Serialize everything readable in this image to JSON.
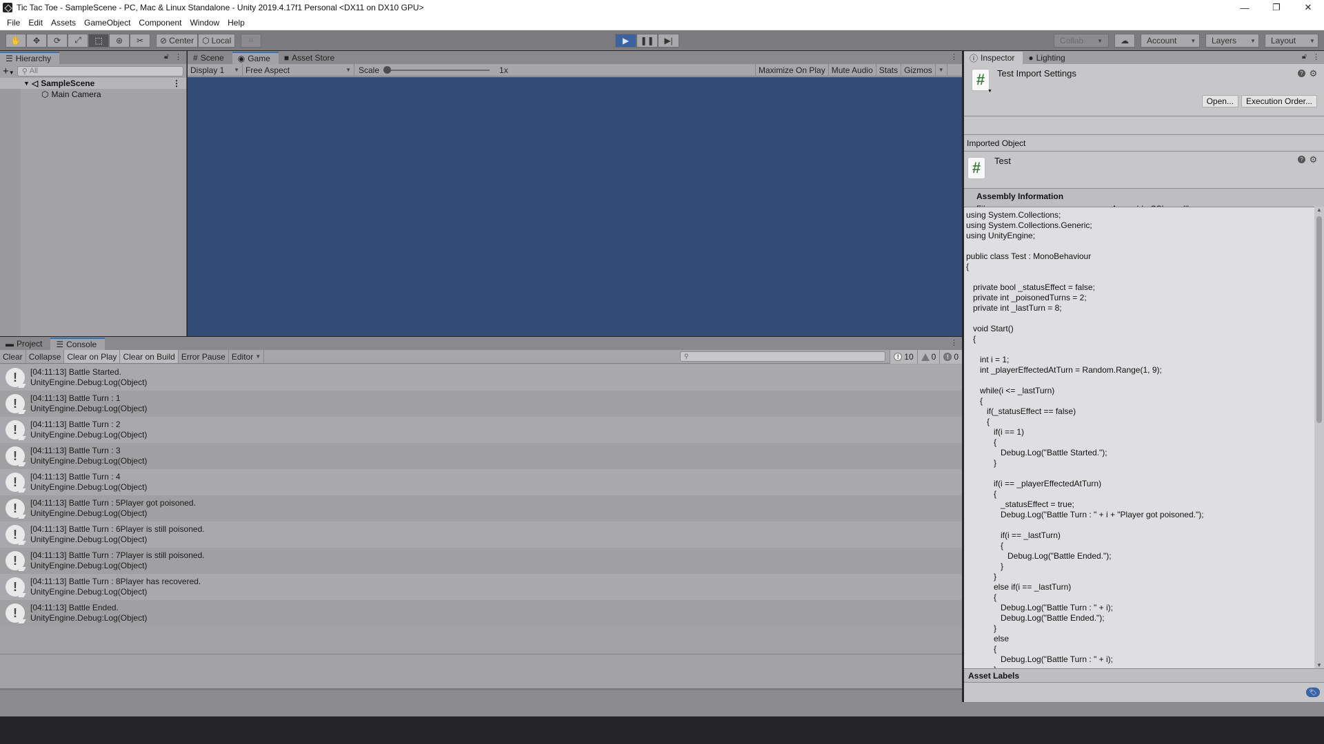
{
  "window": {
    "title": "Tic Tac Toe - SampleScene - PC, Mac & Linux Standalone - Unity 2019.4.17f1 Personal <DX11 on DX10 GPU>",
    "controls": {
      "minimize": "—",
      "maximize": "❐",
      "close": "✕"
    }
  },
  "menu": [
    "File",
    "Edit",
    "Assets",
    "GameObject",
    "Component",
    "Window",
    "Help"
  ],
  "toolbar": {
    "tools": [
      {
        "name": "hand-tool",
        "glyph": "✋"
      },
      {
        "name": "move-tool",
        "glyph": "✥"
      },
      {
        "name": "rotate-tool",
        "glyph": "⟳"
      },
      {
        "name": "scale-tool",
        "glyph": "⤢"
      },
      {
        "name": "rect-tool",
        "glyph": "⬚"
      },
      {
        "name": "transform-tool",
        "glyph": "⊛"
      },
      {
        "name": "custom-tool",
        "glyph": "✂"
      }
    ],
    "pivot_center": "Center",
    "pivot_local": "Local",
    "grid_snap_glyph": "⌗",
    "play": "▶",
    "pause": "❚❚",
    "step": "▶|",
    "collab": "Collab",
    "cloud_glyph": "☁",
    "account": "Account",
    "layers": "Layers",
    "layout": "Layout"
  },
  "hierarchy": {
    "tab": "Hierarchy",
    "add_glyph": "+",
    "search_placeholder": "All",
    "scene": "SampleScene",
    "children": [
      "Main Camera"
    ]
  },
  "center_tabs": [
    {
      "label": "Scene",
      "glyph": "#"
    },
    {
      "label": "Game",
      "glyph": "◉"
    },
    {
      "label": "Asset Store",
      "glyph": "■"
    }
  ],
  "game_toolbar": {
    "display": "Display 1",
    "aspect": "Free Aspect",
    "scale_label": "Scale",
    "scale_value": "1x",
    "scale_fraction": 0.0,
    "maximize_on_play": "Maximize On Play",
    "mute_audio": "Mute Audio",
    "stats": "Stats",
    "gizmos": "Gizmos"
  },
  "game_view_color": "#324b77",
  "bottom_tabs": [
    {
      "label": "Project",
      "glyph": "▬"
    },
    {
      "label": "Console",
      "glyph": "☰"
    }
  ],
  "console": {
    "buttons": [
      "Clear",
      "Collapse",
      "Clear on Play",
      "Clear on Build",
      "Error Pause",
      "Editor"
    ],
    "counts": {
      "log": "10",
      "warning": "0",
      "error": "0"
    },
    "entries": [
      {
        "message": "[04:11:13] Battle Started.",
        "trace": "UnityEngine.Debug:Log(Object)"
      },
      {
        "message": "[04:11:13] Battle Turn : 1",
        "trace": "UnityEngine.Debug:Log(Object)"
      },
      {
        "message": "[04:11:13] Battle Turn : 2",
        "trace": "UnityEngine.Debug:Log(Object)"
      },
      {
        "message": "[04:11:13] Battle Turn : 3",
        "trace": "UnityEngine.Debug:Log(Object)"
      },
      {
        "message": "[04:11:13] Battle Turn : 4",
        "trace": "UnityEngine.Debug:Log(Object)"
      },
      {
        "message": "[04:11:13] Battle Turn : 5Player got poisoned.",
        "trace": "UnityEngine.Debug:Log(Object)"
      },
      {
        "message": "[04:11:13] Battle Turn : 6Player is still poisoned.",
        "trace": "UnityEngine.Debug:Log(Object)"
      },
      {
        "message": "[04:11:13] Battle Turn : 7Player is still poisoned.",
        "trace": "UnityEngine.Debug:Log(Object)"
      },
      {
        "message": "[04:11:13] Battle Turn : 8Player has recovered.",
        "trace": "UnityEngine.Debug:Log(Object)"
      },
      {
        "message": "[04:11:13] Battle Ended.",
        "trace": "UnityEngine.Debug:Log(Object)"
      }
    ]
  },
  "inspector": {
    "tabs": [
      {
        "label": "Inspector",
        "glyph": "ⓘ"
      },
      {
        "label": "Lighting",
        "glyph": "●"
      }
    ],
    "title": "Test Import Settings",
    "open_button": "Open...",
    "execution_order_button": "Execution Order...",
    "imported_object_label": "Imported Object",
    "object_name": "Test",
    "assembly_title": "Assembly Information",
    "filename_label": "Filename",
    "filename_value": "Assembly-CSharp.dll",
    "asset_labels": "Asset Labels",
    "code_lines": [
      "using System.Collections;",
      "using System.Collections.Generic;",
      "using UnityEngine;",
      "",
      "public class Test : MonoBehaviour",
      "{",
      "",
      "   private bool _statusEffect = false;",
      "   private int _poisonedTurns = 2;",
      "   private int _lastTurn = 8;",
      "",
      "   void Start()",
      "   {",
      "",
      "      int i = 1;",
      "      int _playerEffectedAtTurn = Random.Range(1, 9);",
      "",
      "      while(i <= _lastTurn)",
      "      {",
      "         if(_statusEffect == false)",
      "         {",
      "            if(i == 1)",
      "            {",
      "               Debug.Log(\"Battle Started.\");",
      "            }",
      "",
      "            if(i == _playerEffectedAtTurn)",
      "            {",
      "               _statusEffect = true;",
      "               Debug.Log(\"Battle Turn : \" + i + \"Player got poisoned.\");",
      "",
      "               if(i == _lastTurn)",
      "               {",
      "                  Debug.Log(\"Battle Ended.\");",
      "               }",
      "            }",
      "            else if(i == _lastTurn)",
      "            {",
      "               Debug.Log(\"Battle Turn : \" + i);",
      "               Debug.Log(\"Battle Ended.\");",
      "            }",
      "            else",
      "            {",
      "               Debug.Log(\"Battle Turn : \" + i);",
      "            }"
    ]
  }
}
